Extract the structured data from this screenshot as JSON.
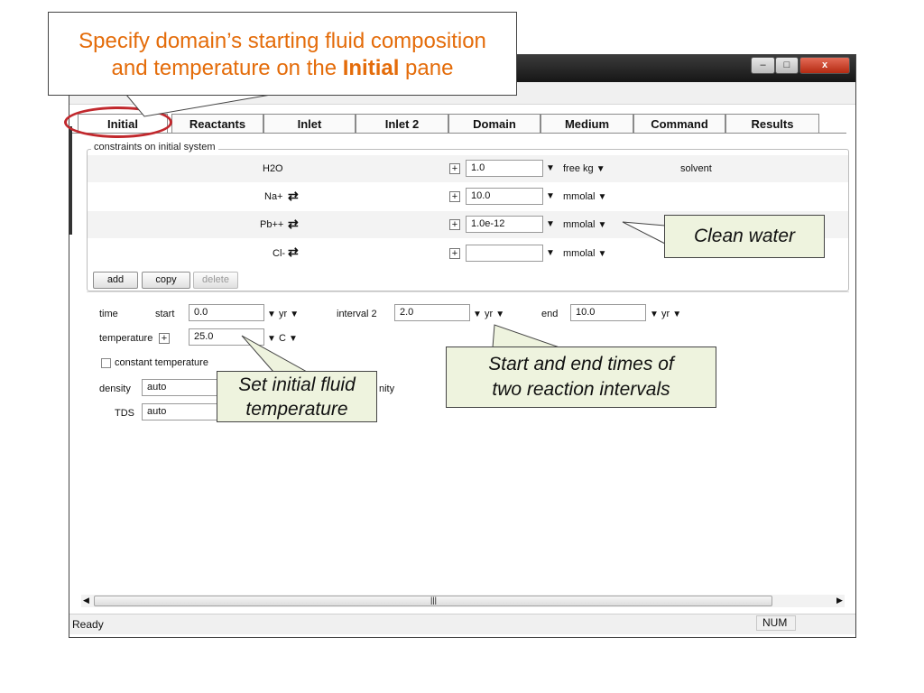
{
  "window": {
    "caption_buttons": [
      "–",
      "□",
      "x"
    ]
  },
  "tabs": [
    "Initial",
    "Reactants",
    "Inlet",
    "Inlet 2",
    "Domain",
    "Medium",
    "Command",
    "Results"
  ],
  "constraints": {
    "group_title": "constraints on initial system",
    "rows": [
      {
        "species": "H2O",
        "value": "1.0",
        "unit": "free kg",
        "note": "solvent",
        "swap": false
      },
      {
        "species": "Na+",
        "value": "10.0",
        "unit": "mmolal",
        "note": "",
        "swap": true
      },
      {
        "species": "Pb++",
        "value": "1.0e-12",
        "unit": "mmolal",
        "note": "",
        "swap": true
      },
      {
        "species": "Cl-",
        "value": "",
        "unit": "mmolal",
        "note": "",
        "swap": true
      }
    ],
    "buttons": {
      "add": "add",
      "copy": "copy",
      "delete": "delete"
    }
  },
  "time": {
    "label": "time",
    "start_label": "start",
    "start_value": "0.0",
    "start_unit": "yr",
    "interval_label": "interval 2",
    "interval_value": "2.0",
    "interval_unit": "yr",
    "end_label": "end",
    "end_value": "10.0",
    "end_unit": "yr"
  },
  "temperature": {
    "label": "temperature",
    "value": "25.0",
    "unit": "C"
  },
  "constant_temperature_label": "constant temperature",
  "density": {
    "label": "density",
    "value": "auto"
  },
  "tds": {
    "label": "TDS",
    "value": "auto"
  },
  "hidden_partial_label": "nity",
  "statusbar": {
    "status": "Ready",
    "num": "NUM"
  },
  "callouts": {
    "top_line1": "Specify domain’s starting fluid composition",
    "top_line2_pre": "and temperature on the ",
    "top_line2_bold": "Initial",
    "top_line2_post": " pane",
    "clean_water": "Clean water",
    "fluid_temp_line1": "Set initial fluid",
    "fluid_temp_line2": "temperature",
    "intervals_line1": "Start and end times of",
    "intervals_line2": "two reaction intervals"
  },
  "colors": {
    "annotation_orange": "#e46c0a",
    "highlight_red": "#c1282d",
    "callout_green": "#eef3de"
  }
}
